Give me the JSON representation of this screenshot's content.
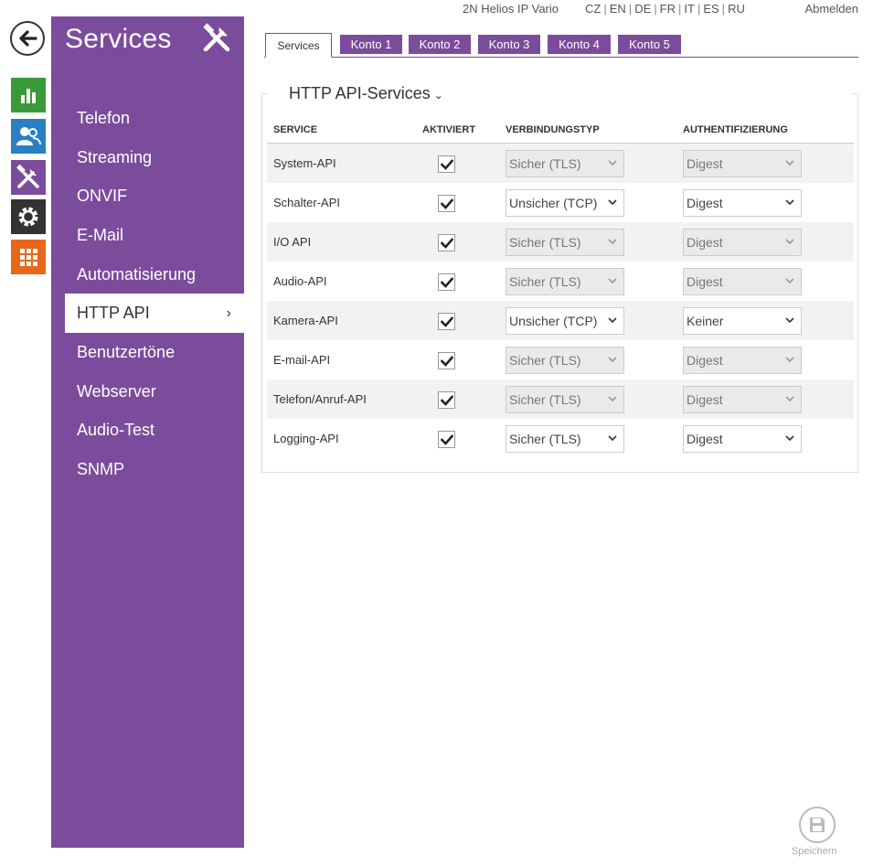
{
  "topbar": {
    "product": "2N Helios IP Vario",
    "languages": [
      "CZ",
      "EN",
      "DE",
      "FR",
      "IT",
      "ES",
      "RU"
    ],
    "logout": "Abmelden"
  },
  "rail": {
    "icons": [
      "back-arrow-icon",
      "status-chart-icon",
      "directory-users-icon",
      "services-tools-icon",
      "system-gear-icon",
      "grid-apps-icon"
    ],
    "colors": {
      "status": "#3a9a3a",
      "directory": "#2a7fc4",
      "services": "#7b4c9c",
      "system": "#333333",
      "apps": "#e8681a"
    }
  },
  "sidebar": {
    "title": "Services",
    "icon": "tools-icon",
    "items": [
      {
        "label": "Telefon"
      },
      {
        "label": "Streaming"
      },
      {
        "label": "ONVIF"
      },
      {
        "label": "E-Mail"
      },
      {
        "label": "Automatisierung"
      },
      {
        "label": "HTTP API",
        "active": true
      },
      {
        "label": "Benutzertöne"
      },
      {
        "label": "Webserver"
      },
      {
        "label": "Audio-Test"
      },
      {
        "label": "SNMP"
      }
    ],
    "accent": "#7b4c9c"
  },
  "tabs": [
    "Services",
    "Konto 1",
    "Konto 2",
    "Konto 3",
    "Konto 4",
    "Konto 5"
  ],
  "section": {
    "title": "HTTP API-Services",
    "columns": {
      "service": "SERVICE",
      "enabled": "AKTIVIERT",
      "connection": "VERBINDUNGSTYP",
      "auth": "AUTHENTIFIZIERUNG"
    },
    "rows": [
      {
        "name": "System-API",
        "enabled": true,
        "connection": "Sicher (TLS)",
        "connection_disabled": true,
        "auth": "Digest",
        "auth_disabled": true
      },
      {
        "name": "Schalter-API",
        "enabled": true,
        "connection": "Unsicher (TCP)",
        "connection_disabled": false,
        "auth": "Digest",
        "auth_disabled": false
      },
      {
        "name": "I/O API",
        "enabled": true,
        "connection": "Sicher (TLS)",
        "connection_disabled": true,
        "auth": "Digest",
        "auth_disabled": true
      },
      {
        "name": "Audio-API",
        "enabled": true,
        "connection": "Sicher (TLS)",
        "connection_disabled": true,
        "auth": "Digest",
        "auth_disabled": true
      },
      {
        "name": "Kamera-API",
        "enabled": true,
        "connection": "Unsicher (TCP)",
        "connection_disabled": false,
        "auth": "Keiner",
        "auth_disabled": false
      },
      {
        "name": "E-mail-API",
        "enabled": true,
        "connection": "Sicher (TLS)",
        "connection_disabled": true,
        "auth": "Digest",
        "auth_disabled": true
      },
      {
        "name": "Telefon/Anruf-API",
        "enabled": true,
        "connection": "Sicher (TLS)",
        "connection_disabled": true,
        "auth": "Digest",
        "auth_disabled": true
      },
      {
        "name": "Logging-API",
        "enabled": true,
        "connection": "Sicher (TLS)",
        "connection_disabled": false,
        "auth": "Digest",
        "auth_disabled": false
      }
    ]
  },
  "save": {
    "label": "Speichern",
    "icon": "floppy-disk-icon"
  }
}
